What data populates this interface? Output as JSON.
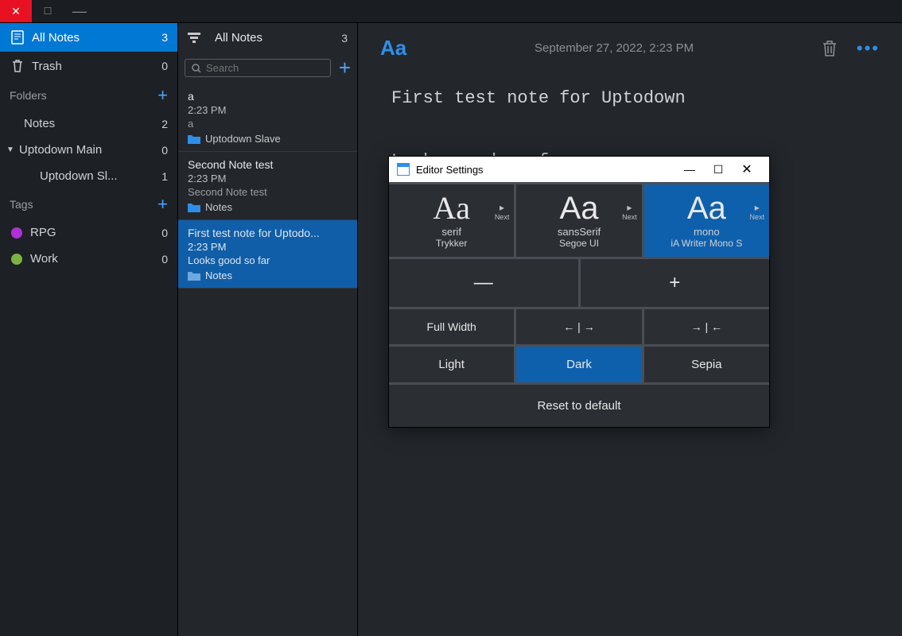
{
  "sidebar": {
    "all_notes": {
      "label": "All Notes",
      "count": "3"
    },
    "trash": {
      "label": "Trash",
      "count": "0"
    },
    "folders_header": "Folders",
    "folders": [
      {
        "label": "Notes",
        "count": "2"
      },
      {
        "label": "Uptodown Main",
        "count": "0"
      },
      {
        "label": "Uptodown Sl...",
        "count": "1"
      }
    ],
    "tags_header": "Tags",
    "tags": [
      {
        "label": "RPG",
        "count": "0",
        "color": "#b030d8"
      },
      {
        "label": "Work",
        "count": "0",
        "color": "#7bb342"
      }
    ]
  },
  "notelist": {
    "title": "All Notes",
    "count": "3",
    "search_placeholder": "Search",
    "items": [
      {
        "title": "a",
        "time": "2:23 PM",
        "preview": "a",
        "folder": "Uptodown Slave"
      },
      {
        "title": "Second Note test",
        "time": "2:23 PM",
        "preview": "Second Note test",
        "folder": "Notes"
      },
      {
        "title": "First test note for Uptodo...",
        "time": "2:23 PM",
        "preview": "Looks good so far",
        "folder": "Notes"
      }
    ]
  },
  "editor": {
    "date": "September 27, 2022, 2:23 PM",
    "body": "First test note for Uptodown\n\nLooks good so far"
  },
  "modal": {
    "title": "Editor Settings",
    "fonts": [
      {
        "type": "serif",
        "name": "Trykker",
        "next": "Next"
      },
      {
        "type": "sansSerif",
        "name": "Segoe UI",
        "next": "Next"
      },
      {
        "type": "mono",
        "name": "iA Writer Mono S",
        "next": "Next"
      }
    ],
    "full_width": "Full Width",
    "themes": {
      "light": "Light",
      "dark": "Dark",
      "sepia": "Sepia"
    },
    "reset": "Reset to default"
  }
}
